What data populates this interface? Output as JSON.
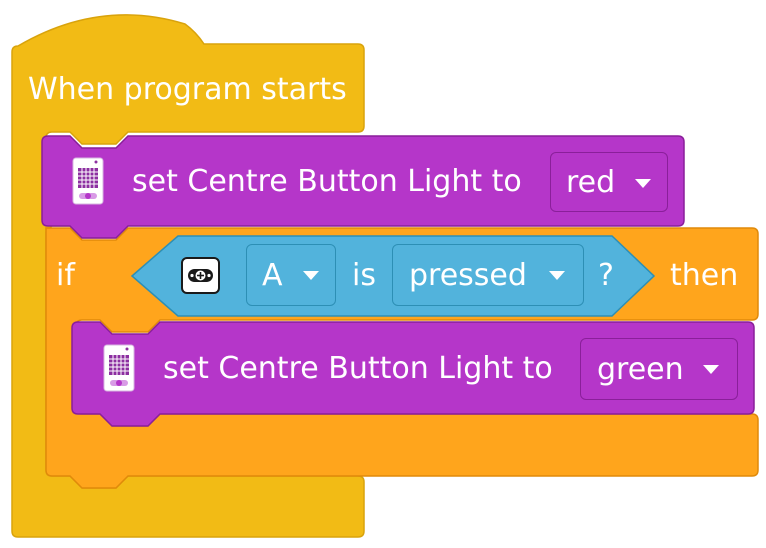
{
  "hat_block": {
    "label": "When program starts"
  },
  "set_light_1": {
    "label": "set Centre Button Light to",
    "value": "red"
  },
  "if_block": {
    "if_label": "if",
    "then_label": "then"
  },
  "condition": {
    "button": "A",
    "is_label": "is",
    "state": "pressed",
    "question": "?"
  },
  "set_light_2": {
    "label": "set Centre Button Light to",
    "value": "green"
  },
  "colors": {
    "event_yellow": "#f2bb15",
    "control_orange": "#ffa51c",
    "light_purple": "#b536c9",
    "sensor_blue": "#52b3dc"
  }
}
